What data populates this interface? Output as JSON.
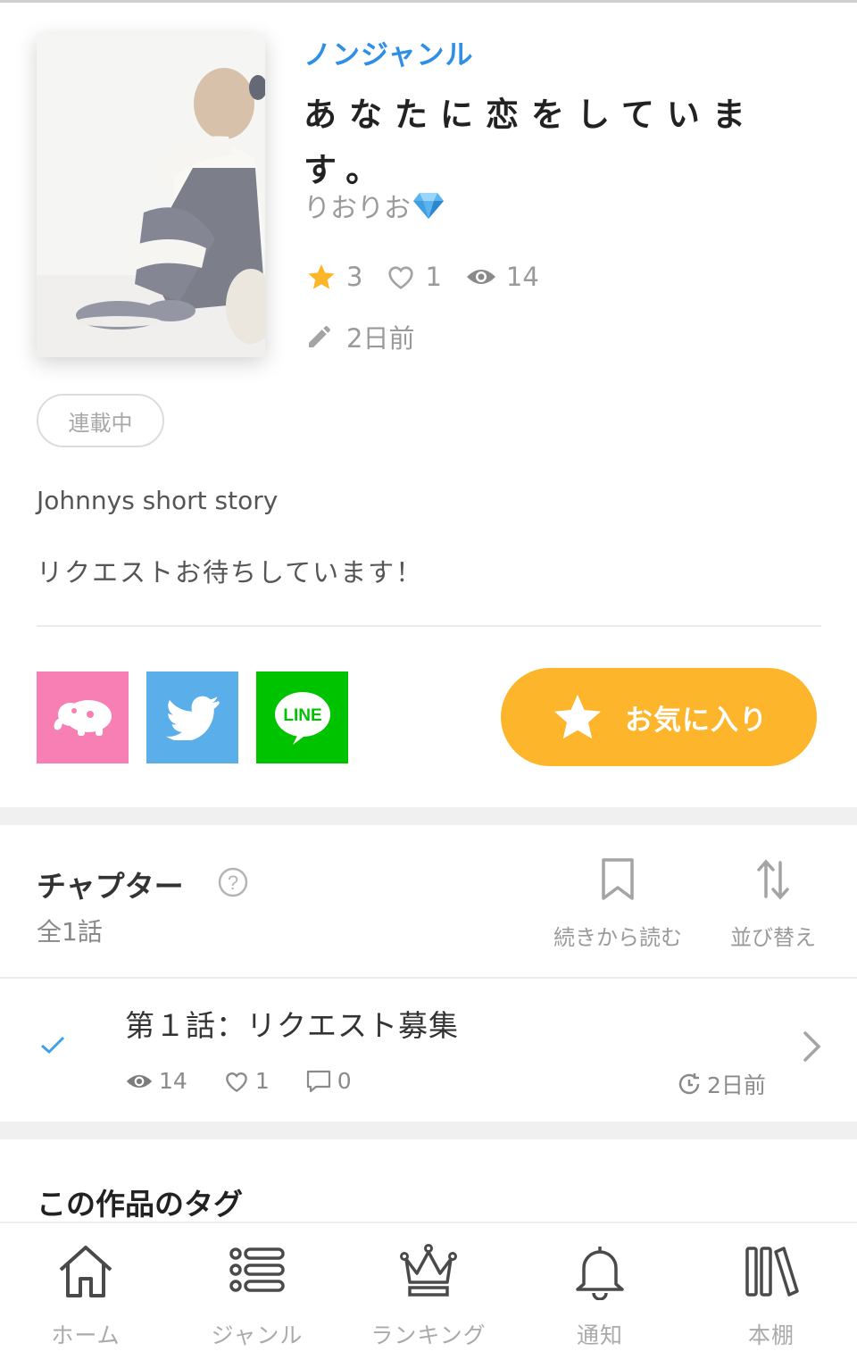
{
  "book": {
    "genre": "ノンジャンル",
    "title": "あなたに恋をしています。",
    "author": "りおりお",
    "author_badge_icon": "gem-icon",
    "stars": "3",
    "likes": "1",
    "views": "14",
    "updated": "2日前",
    "status": "連載中",
    "description_line1": "Johnnys short story",
    "description_line2": "リクエストお待ちしています！"
  },
  "share": {
    "maho_icon": "elephant-icon",
    "twitter_icon": "twitter-bird-icon",
    "line_label": "LINE"
  },
  "favorite": {
    "label": "お気に入り",
    "color": "#fdb62c"
  },
  "chapters": {
    "title": "チャプター",
    "count": "全1話",
    "continue_label": "続きから読む",
    "sort_label": "並び替え",
    "items": [
      {
        "name": "第１話：リクエスト募集",
        "views": "14",
        "likes": "1",
        "comments": "0",
        "date": "2日前",
        "read": true
      }
    ]
  },
  "tags": {
    "title": "この作品のタグ"
  },
  "nav": {
    "items": [
      {
        "label": "ホーム",
        "icon": "home-icon"
      },
      {
        "label": "ジャンル",
        "icon": "list-icon"
      },
      {
        "label": "ランキング",
        "icon": "crown-icon"
      },
      {
        "label": "通知",
        "icon": "bell-icon"
      },
      {
        "label": "本棚",
        "icon": "bookshelf-icon"
      }
    ]
  },
  "colors": {
    "accent_blue": "#2f8fe6",
    "favorite_yellow": "#fdb62c",
    "maho_pink": "#f77fb4",
    "twitter_blue": "#5aaeea",
    "line_green": "#00c300"
  }
}
